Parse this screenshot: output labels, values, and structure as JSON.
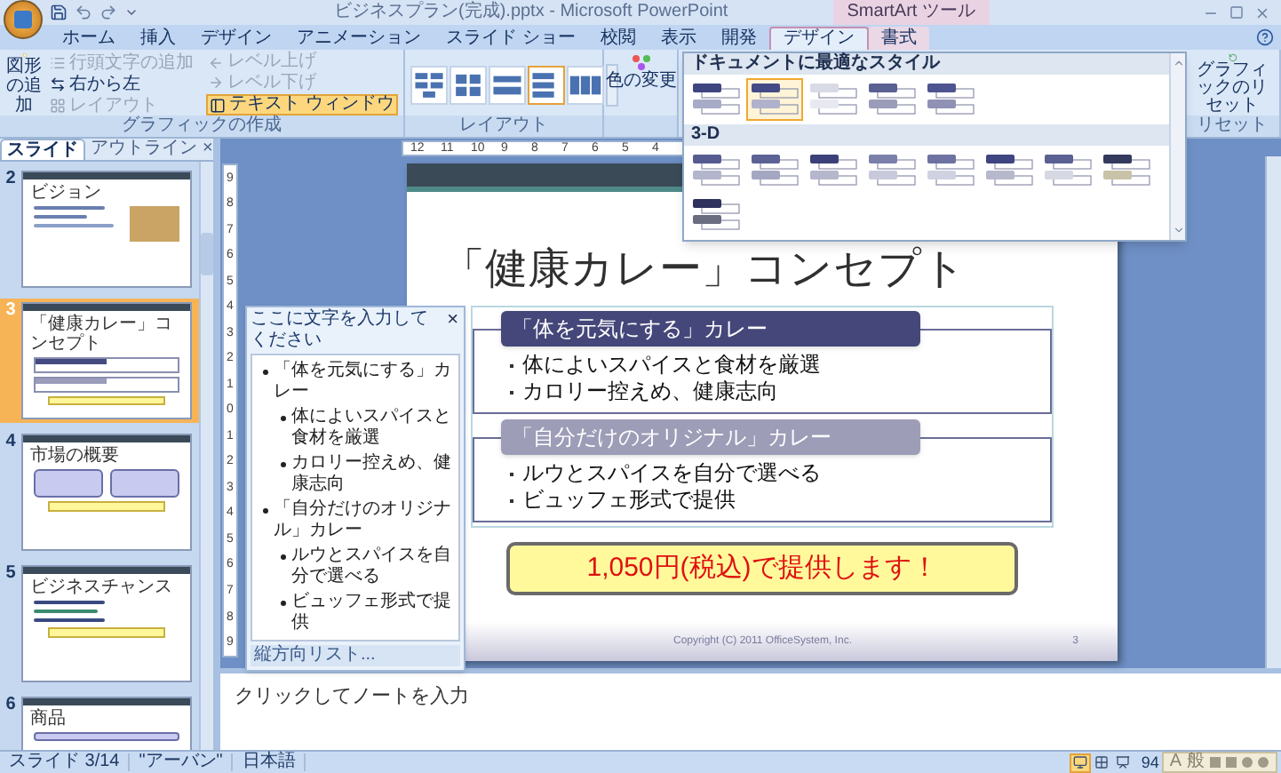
{
  "window": {
    "title": "ビジネスプラン(完成).pptx - Microsoft PowerPoint",
    "context_label": "SmartArt ツール"
  },
  "tabs": [
    {
      "label": "ホーム",
      "selected": false,
      "contextual": false
    },
    {
      "label": "挿入",
      "selected": false,
      "contextual": false
    },
    {
      "label": "デザイン",
      "selected": false,
      "contextual": false
    },
    {
      "label": "アニメーション",
      "selected": false,
      "contextual": false
    },
    {
      "label": "スライド ショー",
      "selected": false,
      "contextual": false
    },
    {
      "label": "校閲",
      "selected": false,
      "contextual": false
    },
    {
      "label": "表示",
      "selected": false,
      "contextual": false
    },
    {
      "label": "開発",
      "selected": false,
      "contextual": false
    },
    {
      "label": "デザイン",
      "selected": true,
      "contextual": true
    },
    {
      "label": "書式",
      "selected": false,
      "contextual": true
    }
  ],
  "ribbon": {
    "create_group": {
      "label": "グラフィックの作成",
      "add_shape": "図形の追加",
      "buttons": [
        {
          "label": "行頭文字の追加",
          "disabled": true,
          "selected": false,
          "kind": "bullet"
        },
        {
          "label": "右から左",
          "disabled": false,
          "selected": false,
          "kind": "rtl"
        },
        {
          "label": "レイアウト",
          "disabled": true,
          "selected": false,
          "kind": "layout"
        },
        {
          "label": "レベル上げ",
          "disabled": true,
          "selected": false,
          "kind": "promote"
        },
        {
          "label": "レベル下げ",
          "disabled": true,
          "selected": false,
          "kind": "demote"
        },
        {
          "label": "テキスト ウィンドウ",
          "disabled": false,
          "selected": true,
          "kind": "textpane"
        }
      ]
    },
    "layout_group": {
      "label": "レイアウト",
      "layouts": [
        {
          "selected": false
        },
        {
          "selected": false
        },
        {
          "selected": false
        },
        {
          "selected": true
        },
        {
          "selected": false
        }
      ]
    },
    "color_button": "色の変更",
    "style_gallery": {
      "sections": [
        {
          "title": "ドキュメントに最適なスタイル",
          "styles": [
            {
              "selected": false
            },
            {
              "selected": true
            },
            {
              "selected": false
            },
            {
              "selected": false
            },
            {
              "selected": false
            }
          ]
        },
        {
          "title": "3-D",
          "styles": [
            {
              "selected": false
            },
            {
              "selected": false
            },
            {
              "selected": false
            },
            {
              "selected": false
            },
            {
              "selected": false
            },
            {
              "selected": false
            },
            {
              "selected": false
            },
            {
              "selected": false
            },
            {
              "selected": false
            }
          ]
        }
      ]
    },
    "reset_group": {
      "label": "リセット",
      "button": "グラフィックのリセット"
    }
  },
  "slide_panel": {
    "tabs": [
      {
        "label": "スライド",
        "selected": true
      },
      {
        "label": "アウトライン",
        "selected": false
      }
    ],
    "close": "×",
    "slides": [
      {
        "number": "2",
        "title": "ビジョン",
        "kind": "photo",
        "selected": false
      },
      {
        "number": "3",
        "title": "「健康カレー」コンセプト",
        "kind": "list",
        "selected": true
      },
      {
        "number": "4",
        "title": "市場の概要",
        "kind": "columns",
        "selected": false
      },
      {
        "number": "5",
        "title": "ビジネスチャンス",
        "kind": "numbered",
        "selected": false
      },
      {
        "number": "6",
        "title": "商品",
        "kind": "boxes",
        "selected": false
      }
    ]
  },
  "ruler": {
    "horizontal": [
      "12",
      "11",
      "10",
      "9",
      "8",
      "7",
      "6",
      "5",
      "4"
    ],
    "vertical": [
      "9",
      "8",
      "7",
      "6",
      "5",
      "4",
      "3",
      "2",
      "1",
      "0",
      "1",
      "2",
      "3",
      "4",
      "5",
      "6",
      "7",
      "8",
      "9"
    ]
  },
  "slide": {
    "title": "「健康カレー」コンセプト",
    "sections": [
      {
        "heading": "「体を元気にする」カレー",
        "kind": "primary",
        "bullets": [
          "体によいスパイスと食材を厳選",
          "カロリー控えめ、健康志向"
        ]
      },
      {
        "heading": "「自分だけのオリジナル」カレー",
        "kind": "secondary",
        "bullets": [
          "ルウとスパイスを自分で選べる",
          "ビュッフェ形式で提供"
        ]
      }
    ],
    "callout": "1,050円(税込)で提供します！",
    "footer": "Copyright (C) 2011 OfficeSystem, Inc.",
    "page_number": "3"
  },
  "text_pane": {
    "title": "ここに文字を入力してください",
    "close": "×",
    "items": [
      {
        "text": "「体を元気にする」カレー",
        "children": [
          {
            "text": "体によいスパイスと食材を厳選"
          },
          {
            "text": "カロリー控えめ、健康志向"
          }
        ]
      },
      {
        "text": "「自分だけのオリジナル」カレー",
        "children": [
          {
            "text": "ルウとスパイスを自分で選べる"
          },
          {
            "text": "ビュッフェ形式で提供"
          }
        ]
      }
    ],
    "footer": "縦方向リスト..."
  },
  "notes": {
    "placeholder": "クリックしてノートを入力"
  },
  "status_bar": {
    "items": [
      "スライド 3/14",
      "\"アーバン\"",
      "日本語"
    ],
    "views": [
      {
        "selected": true
      },
      {
        "selected": false
      },
      {
        "selected": false
      }
    ],
    "zoom": "94",
    "ime": [
      "A",
      "般"
    ]
  }
}
